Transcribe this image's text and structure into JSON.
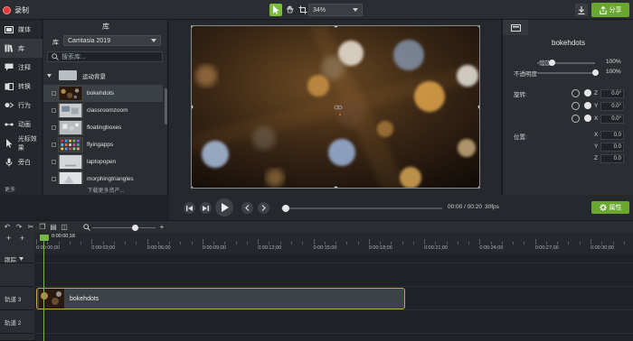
{
  "topbar": {
    "record_label": "录制",
    "zoom_value": "34%",
    "share_label": "分享"
  },
  "rail": {
    "items": [
      {
        "label": "媒体",
        "icon": "media-icon"
      },
      {
        "label": "库",
        "icon": "library-icon"
      },
      {
        "label": "注释",
        "icon": "annotation-icon"
      },
      {
        "label": "转换",
        "icon": "transition-icon"
      },
      {
        "label": "行为",
        "icon": "behavior-icon"
      },
      {
        "label": "动画",
        "icon": "animation-icon"
      },
      {
        "label": "光标效果",
        "icon": "cursor-effect-icon"
      },
      {
        "label": "旁白",
        "icon": "microphone-icon"
      }
    ],
    "more_label": "更多"
  },
  "library": {
    "title": "库",
    "selector_label": "库",
    "selected_library": "Camtasia 2019",
    "search_placeholder": "搜索库...",
    "folder": "运动背景",
    "items": [
      "bokehdots",
      "classroomzoom",
      "floatingboxes",
      "flyingapps",
      "laptopopen",
      "morphingtriangles"
    ],
    "more_link": "下载更多资产..."
  },
  "properties": {
    "title": "bokehdots",
    "scale_label": "缩放",
    "scale_value": "100%",
    "scale_level": 0.25,
    "opacity_label": "不透明度",
    "opacity_value": "100%",
    "opacity_level": 1.0,
    "rotation_label": "旋转:",
    "rotation": [
      {
        "axis": "Z",
        "value": "0.0°"
      },
      {
        "axis": "Y",
        "value": "0.0°"
      },
      {
        "axis": "X",
        "value": "0.0°"
      }
    ],
    "position_label": "位置:",
    "position": [
      {
        "axis": "X",
        "value": "0.0"
      },
      {
        "axis": "Y",
        "value": "0.0"
      },
      {
        "axis": "Z",
        "value": "0.0"
      }
    ]
  },
  "player": {
    "time": "00:00 / 00:20",
    "fps": "30fps",
    "properties_label": "属性",
    "progress": 0.0
  },
  "timeline": {
    "playhead_time": "0:00:00;18",
    "ruler_labels": [
      "0:00:00;00",
      "0:00:03;00",
      "0:00:06;00",
      "0:00:09;00",
      "0:00:12;00",
      "0:00:15;00",
      "0:00:18;00",
      "0:00:21;00",
      "0:00:24;00",
      "0:00:27;00",
      "0:00:30;00"
    ],
    "tracks": [
      {
        "label": "跟踪"
      },
      {
        "label": "轨道 3"
      },
      {
        "label": "轨道 2"
      }
    ],
    "clip_name": "bokehdots"
  },
  "colors": {
    "accent_green": "#6aa72e",
    "record_red": "#e03b3b",
    "clip_border": "#c8a24a"
  }
}
